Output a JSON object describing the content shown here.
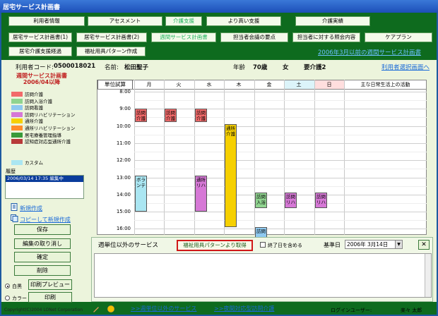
{
  "window": {
    "title": "居宅サービス計画書"
  },
  "nav_row1": [
    "利用者情報",
    "アセスメント",
    "介護支援",
    "より高い支援",
    "介護実績"
  ],
  "nav_row2": [
    "居宅サービス計画書(1)",
    "居宅サービス計画書(2)",
    "週間サービス計画書",
    "担当者会議の要点",
    "担当者に対する照会内容",
    "ケアプラン"
  ],
  "nav_row3": [
    "居宅介護支援経過",
    "福祉用具パターン作成"
  ],
  "old_plan_link": "2006年3月以前の週間サービス計画書",
  "user": {
    "code_label": "利用者コード:",
    "code": "0500018021",
    "name_label": "名前:",
    "name": "松田聖子",
    "age_label": "年齢",
    "age": "70歳",
    "sex": "女",
    "care_level": "要介護2",
    "select_link": "利用者選択画面へ"
  },
  "left": {
    "title_line1": "週間サービス計画書",
    "title_line2": "2006/04以降",
    "legend": [
      {
        "label": "訪問介護",
        "color": "#f26a6a"
      },
      {
        "label": "訪問入浴介護",
        "color": "#8fd48f"
      },
      {
        "label": "訪問看護",
        "color": "#8ec9f0"
      },
      {
        "label": "訪問リハビリテーション",
        "color": "#d678d6"
      },
      {
        "label": "通所介護",
        "color": "#f6d000"
      },
      {
        "label": "通所リハビリテーション",
        "color": "#ff8c2a"
      },
      {
        "label": "居宅療養管理指導",
        "color": "#3a9a3a"
      },
      {
        "label": "認知症対応型通所介護",
        "color": "#b83a3a"
      },
      {
        "label": "カスタム",
        "color": "#aae6f2"
      }
    ],
    "history_label": "履歴",
    "history_entry": "2006/03/14 17:35 編集中",
    "new_link": "新規作成",
    "copy_link": "コピーして新規作成",
    "buttons": [
      "保存",
      "編集の取り消し",
      "確定",
      "削除",
      "印刷プレビュー",
      "印刷"
    ],
    "radio_mono": "白黒",
    "radio_color": "カラー"
  },
  "calendar": {
    "unit_button": "単位試算",
    "days": [
      "月",
      "火",
      "水",
      "木",
      "金",
      "土",
      "日"
    ],
    "activities_header": "主な日常生活上の活動",
    "hours": [
      "8:00",
      "9:00",
      "10:00",
      "11:00",
      "12:00",
      "13:00",
      "14:00",
      "15:00",
      "16:00"
    ],
    "services": [
      {
        "day": 0,
        "label": "訪問介護",
        "start": 9.0,
        "end": 9.8,
        "color": "#f26a6a"
      },
      {
        "day": 1,
        "label": "訪問介護",
        "start": 9.0,
        "end": 9.8,
        "color": "#f26a6a"
      },
      {
        "day": 2,
        "label": "訪問介護",
        "start": 9.0,
        "end": 9.8,
        "color": "#f26a6a"
      },
      {
        "day": 3,
        "label": "通所介護",
        "start": 9.9,
        "end": 15.9,
        "color": "#f6d000"
      },
      {
        "day": 0,
        "label": "ボランテ",
        "start": 12.9,
        "end": 15.0,
        "color": "#aae6f2"
      },
      {
        "day": 2,
        "label": "通所リハ",
        "start": 12.9,
        "end": 15.0,
        "color": "#d678d6"
      },
      {
        "day": 4,
        "label": "訪問入浴",
        "start": 13.9,
        "end": 14.8,
        "color": "#8fd48f"
      },
      {
        "day": 5,
        "label": "訪問リハ",
        "start": 13.9,
        "end": 14.8,
        "color": "#d678d6"
      },
      {
        "day": 6,
        "label": "訪問リハ",
        "start": 13.9,
        "end": 14.8,
        "color": "#d678d6"
      },
      {
        "day": 4,
        "label": "訪問",
        "start": 15.9,
        "end": 16.5,
        "color": "#8ec9f0"
      }
    ]
  },
  "bottom": {
    "title": "週単位以外のサービス",
    "welfare_button": "福祉用具パターンより取得",
    "include_end_label": "終了日を含める",
    "base_date_label": "基準日",
    "base_date": "2006年 3月14日",
    "close": "✕"
  },
  "status": {
    "copyright": "Copyright(C)2004 LONet Corporation",
    "link1": ">>週単位以外のサービス",
    "link2": ">>夜間対応型訪問介護",
    "login_label": "ログインユーザー:",
    "login_user": "楽々 太郎"
  }
}
